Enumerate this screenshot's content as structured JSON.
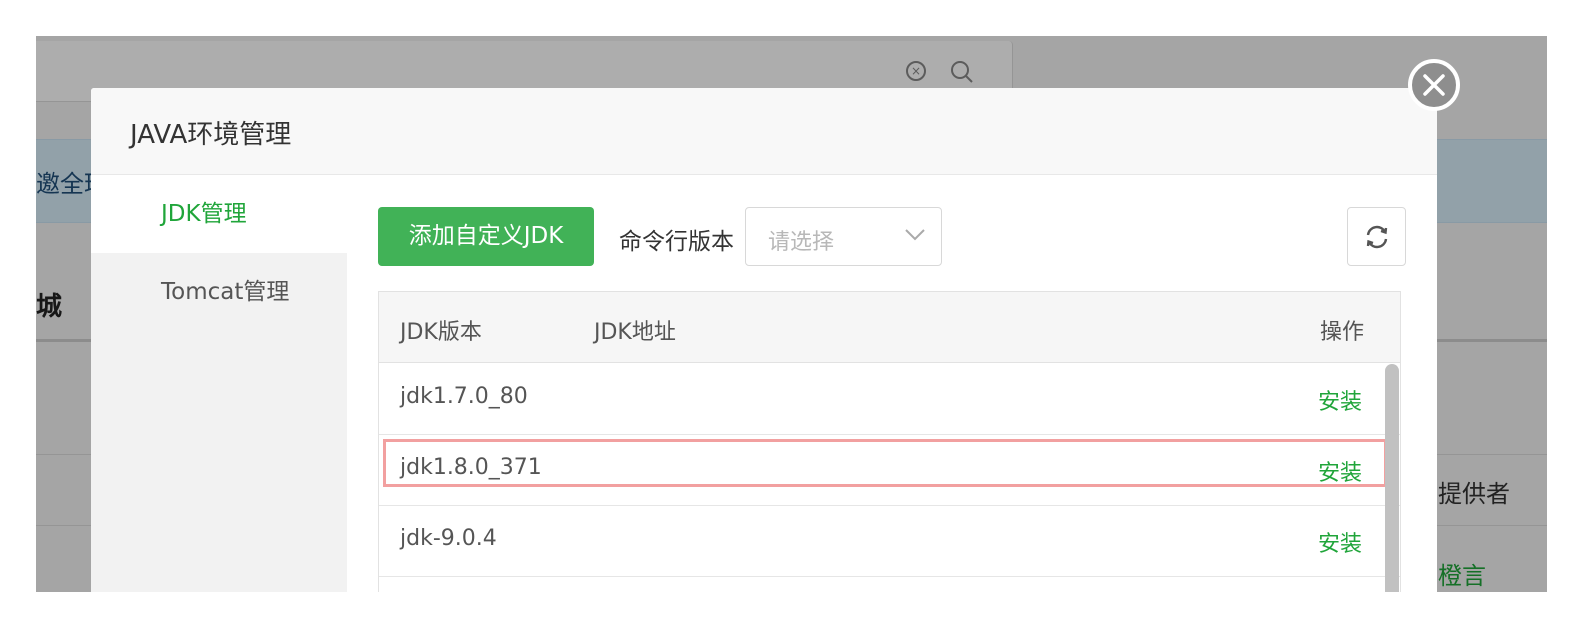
{
  "background": {
    "banner_text": "邀全球",
    "section_title": "城",
    "column_header": "提供者",
    "link_text": "橙言"
  },
  "dialog": {
    "title": "JAVA环境管理",
    "close_icon": "close-icon"
  },
  "sidebar": {
    "items": [
      {
        "label": "JDK管理",
        "active": true
      },
      {
        "label": "Tomcat管理",
        "active": false
      }
    ]
  },
  "toolbar": {
    "add_button_label": "添加自定义JDK",
    "cmd_version_label": "命令行版本",
    "select_placeholder": "请选择",
    "refresh_icon": "refresh-icon"
  },
  "table": {
    "headers": {
      "version": "JDK版本",
      "path": "JDK地址",
      "action": "操作"
    },
    "rows": [
      {
        "version": "jdk1.7.0_80",
        "path": "",
        "action": "安装"
      },
      {
        "version": "jdk1.8.0_371",
        "path": "",
        "action": "安装"
      },
      {
        "version": "jdk-9.0.4",
        "path": "",
        "action": "安装"
      }
    ]
  },
  "colors": {
    "accent": "#20a53a",
    "highlight": "#f2a0a0"
  }
}
